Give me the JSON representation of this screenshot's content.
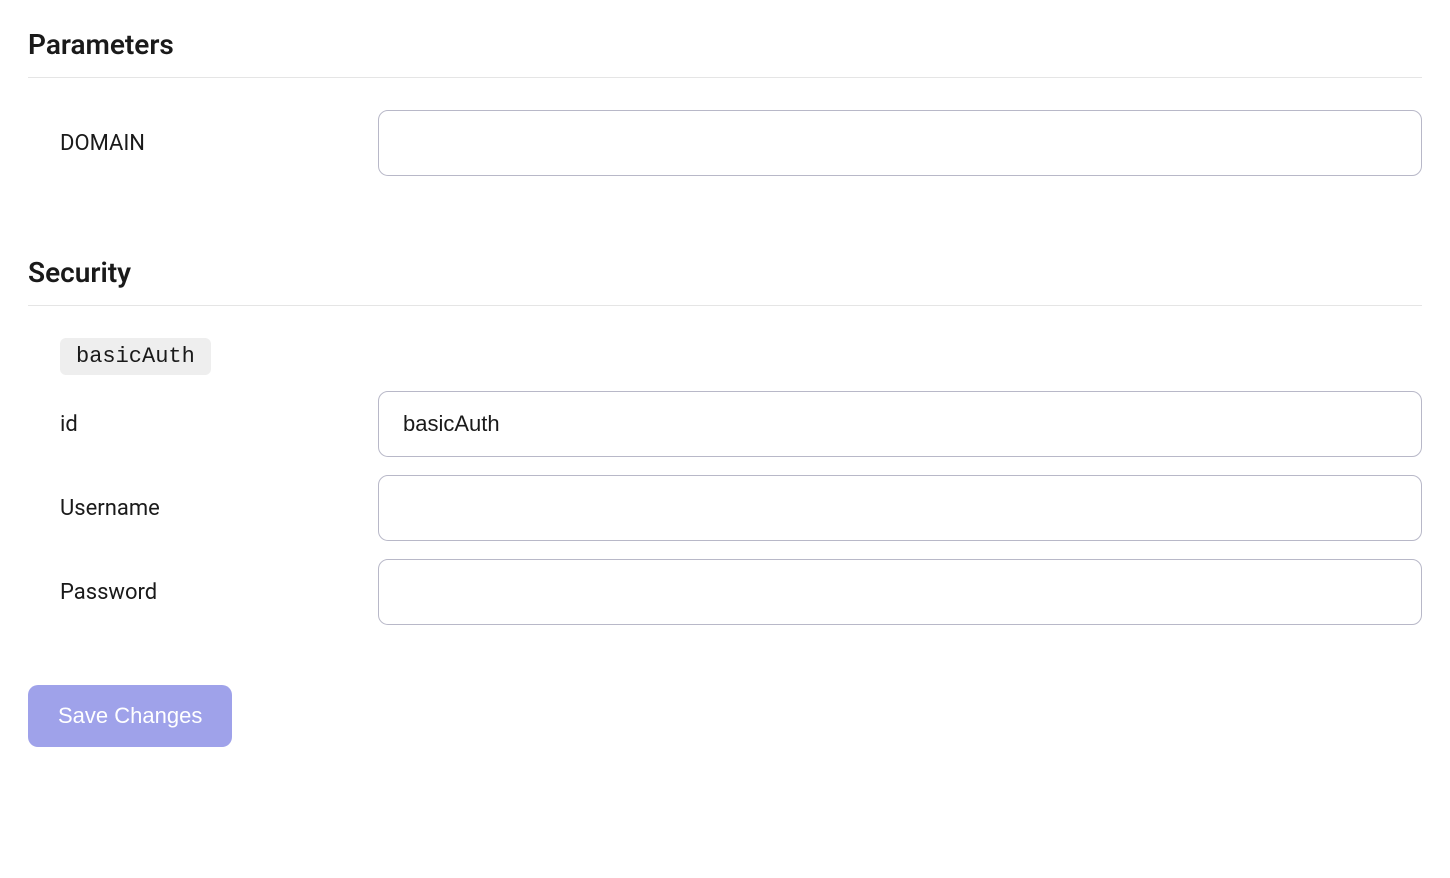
{
  "parameters": {
    "heading": "Parameters",
    "fields": {
      "domain": {
        "label": "DOMAIN",
        "value": ""
      }
    }
  },
  "security": {
    "heading": "Security",
    "auth_badge": "basicAuth",
    "fields": {
      "id": {
        "label": "id",
        "value": "basicAuth"
      },
      "username": {
        "label": "Username",
        "value": ""
      },
      "password": {
        "label": "Password",
        "value": ""
      }
    }
  },
  "actions": {
    "save_label": "Save Changes"
  }
}
